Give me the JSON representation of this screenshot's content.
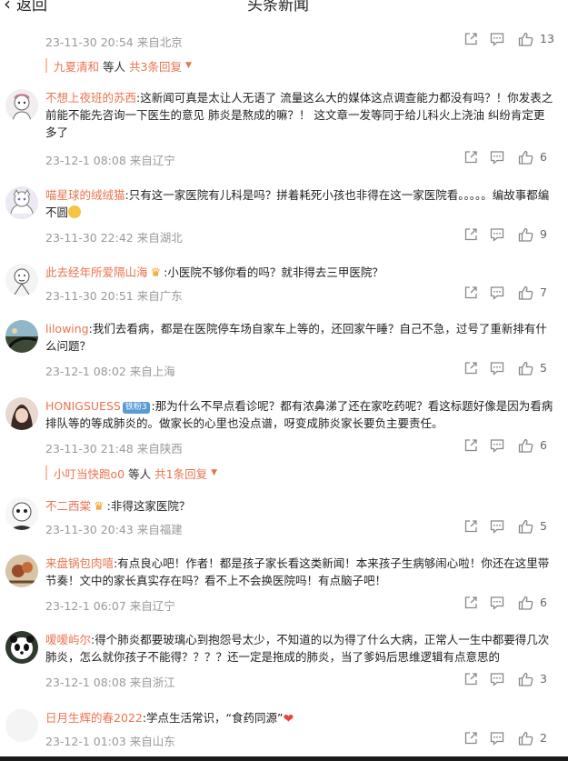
{
  "header": {
    "back_label": "返回",
    "title": "头条新闻"
  },
  "top_item": {
    "meta": "23-11-30 20:54 来自北京",
    "likes": "13",
    "reply_name": "九夏清和",
    "reply_mid": "等人",
    "reply_count": "共3条回复"
  },
  "comments": [
    {
      "user": "不想上夜班的苏西",
      "text": ":这新闻可真是太让人无语了 流量这么大的媒体这点调查能力都没有吗？！你发表之前能不能先咨询一下医生的意见 肺炎是熬成的嘛？！ 这文章一发等同于给儿科火上浇油 纠纷肯定更多了",
      "meta": "23-12-1 08:08 来自辽宁",
      "likes": "6"
    },
    {
      "user": "喵星球的绒绒猫",
      "text": ":只有这一家医院有儿科是吗？拼着耗死小孩也非得在这一家医院看。。。。。编故事都编不圆",
      "meta": "23-11-30 22:42 来自湖北",
      "likes": "9"
    },
    {
      "user": "此去经年所爱隔山海",
      "text": ":小医院不够你看的吗？就非得去三甲医院？",
      "meta": "23-11-30 20:51 来自广东",
      "likes": "7"
    },
    {
      "user": "lilowing",
      "text": ":我们去看病，都是在医院停车场自家车上等的，还回家午睡？自己不急，过号了重新排有什么问题？",
      "meta": "23-12-1 08:02 来自上海",
      "likes": "5"
    },
    {
      "user": "HONIGSUESS",
      "badge": "铁粉3",
      "text": ":那为什么不早点看诊呢？都有浓鼻涕了还在家吃药呢？看这标题好像是因为看病排队等的等成肺炎的。做家长的心里也没点谱，呀变成肺炎家长要负主要责任。",
      "meta": "23-11-30 21:48 来自陕西",
      "likes": "6",
      "reply_name": "小叮当快跑o0",
      "reply_mid": "等人",
      "reply_count": "共1条回复"
    },
    {
      "user": "不二西棠",
      "text": ":非得这家医院？",
      "meta": "23-11-30 20:43 来自福建",
      "likes": "5"
    },
    {
      "user": "来盘锅包肉嘻",
      "text": ":有点良心吧！作者！都是孩子家长看这类新闻！本来孩子生病够闹心啦！你还在这里带节奏！文中的家长真实存在吗？看不上不会换医院吗！有点脑子吧！",
      "meta": "23-12-1 06:07 来自辽宁",
      "likes": "6"
    },
    {
      "user": "嗳嗳屿尔",
      "text": ":得个肺炎都要玻璃心到抱怨号太少，不知道的以为得了什么大病，正常人一生中都要得几次肺炎，怎么就你孩子不能得？？？？还一定是拖成的肺炎，当了爹妈后思维逻辑有点意思的",
      "meta": "23-12-1 08:08 来自浙江",
      "likes": "3"
    },
    {
      "user": "日月生辉的春2022",
      "text": ":学点生活常识，“食药同源”",
      "meta": "23-12-1 01:03 来自山东",
      "likes": "2"
    }
  ],
  "icons": {
    "share": "share-icon",
    "comment": "comment-icon",
    "like": "thumbs-up-icon",
    "crown": "crown-icon",
    "emoji": "smile-emoji-icon",
    "heart": "heart-icon"
  },
  "colors": {
    "username": "#eb7350",
    "meta": "#999999",
    "badge": "#5b9bd5"
  }
}
